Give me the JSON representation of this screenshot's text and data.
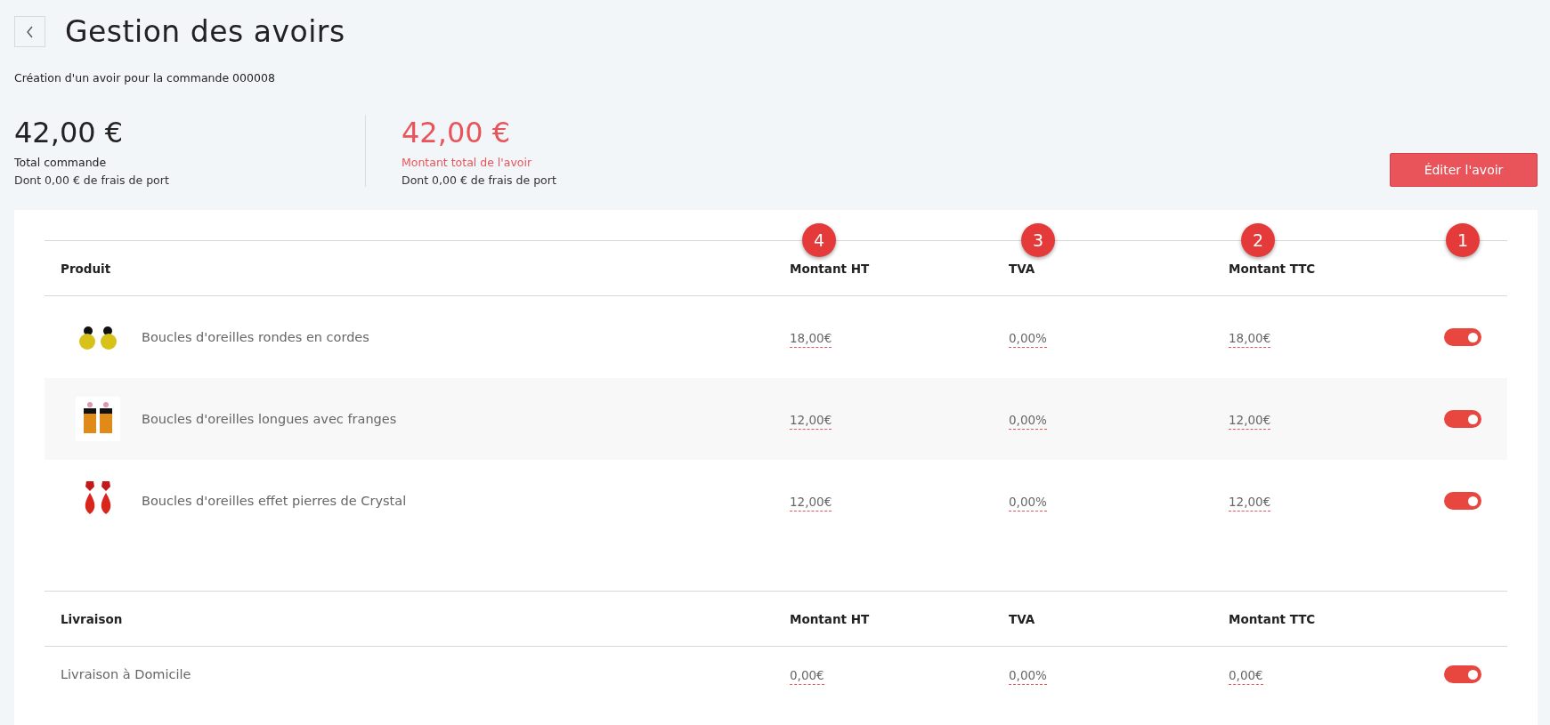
{
  "page": {
    "title": "Gestion des avoirs",
    "subtitle": "Création d'un avoir pour la commande 000008"
  },
  "summary": [
    {
      "amount": "42,00 €",
      "label": "Total commande",
      "note": "Dont 0,00 € de frais de port",
      "kind": "order"
    },
    {
      "amount": "42,00 €",
      "label": "Montant total de l'avoir",
      "note": "Dont 0,00 € de frais de port",
      "kind": "credit"
    }
  ],
  "edit_button": "Éditer l'avoir",
  "markers": [
    "4",
    "3",
    "2",
    "1"
  ],
  "products": {
    "columns": [
      "Produit",
      "Montant HT",
      "TVA",
      "Montant TTC"
    ],
    "rows": [
      {
        "name": "Boucles d'oreilles rondes en cordes",
        "kind": "round",
        "ht": "18,00€",
        "tva": "0,00%",
        "ttc": "18,00€",
        "on": true
      },
      {
        "name": "Boucles d'oreilles longues avec franges",
        "kind": "fringe",
        "ht": "12,00€",
        "tva": "0,00%",
        "ttc": "12,00€",
        "on": true
      },
      {
        "name": "Boucles d'oreilles effet pierres de Crystal",
        "kind": "crystal",
        "ht": "12,00€",
        "tva": "0,00%",
        "ttc": "12,00€",
        "on": true
      }
    ]
  },
  "delivery": {
    "columns": [
      "Livraison",
      "Montant HT",
      "TVA",
      "Montant TTC"
    ],
    "rows": [
      {
        "name": "Livraison à Domicile",
        "ht": "0,00€",
        "tva": "0,00%",
        "ttc": "0,00€",
        "on": true
      }
    ]
  }
}
